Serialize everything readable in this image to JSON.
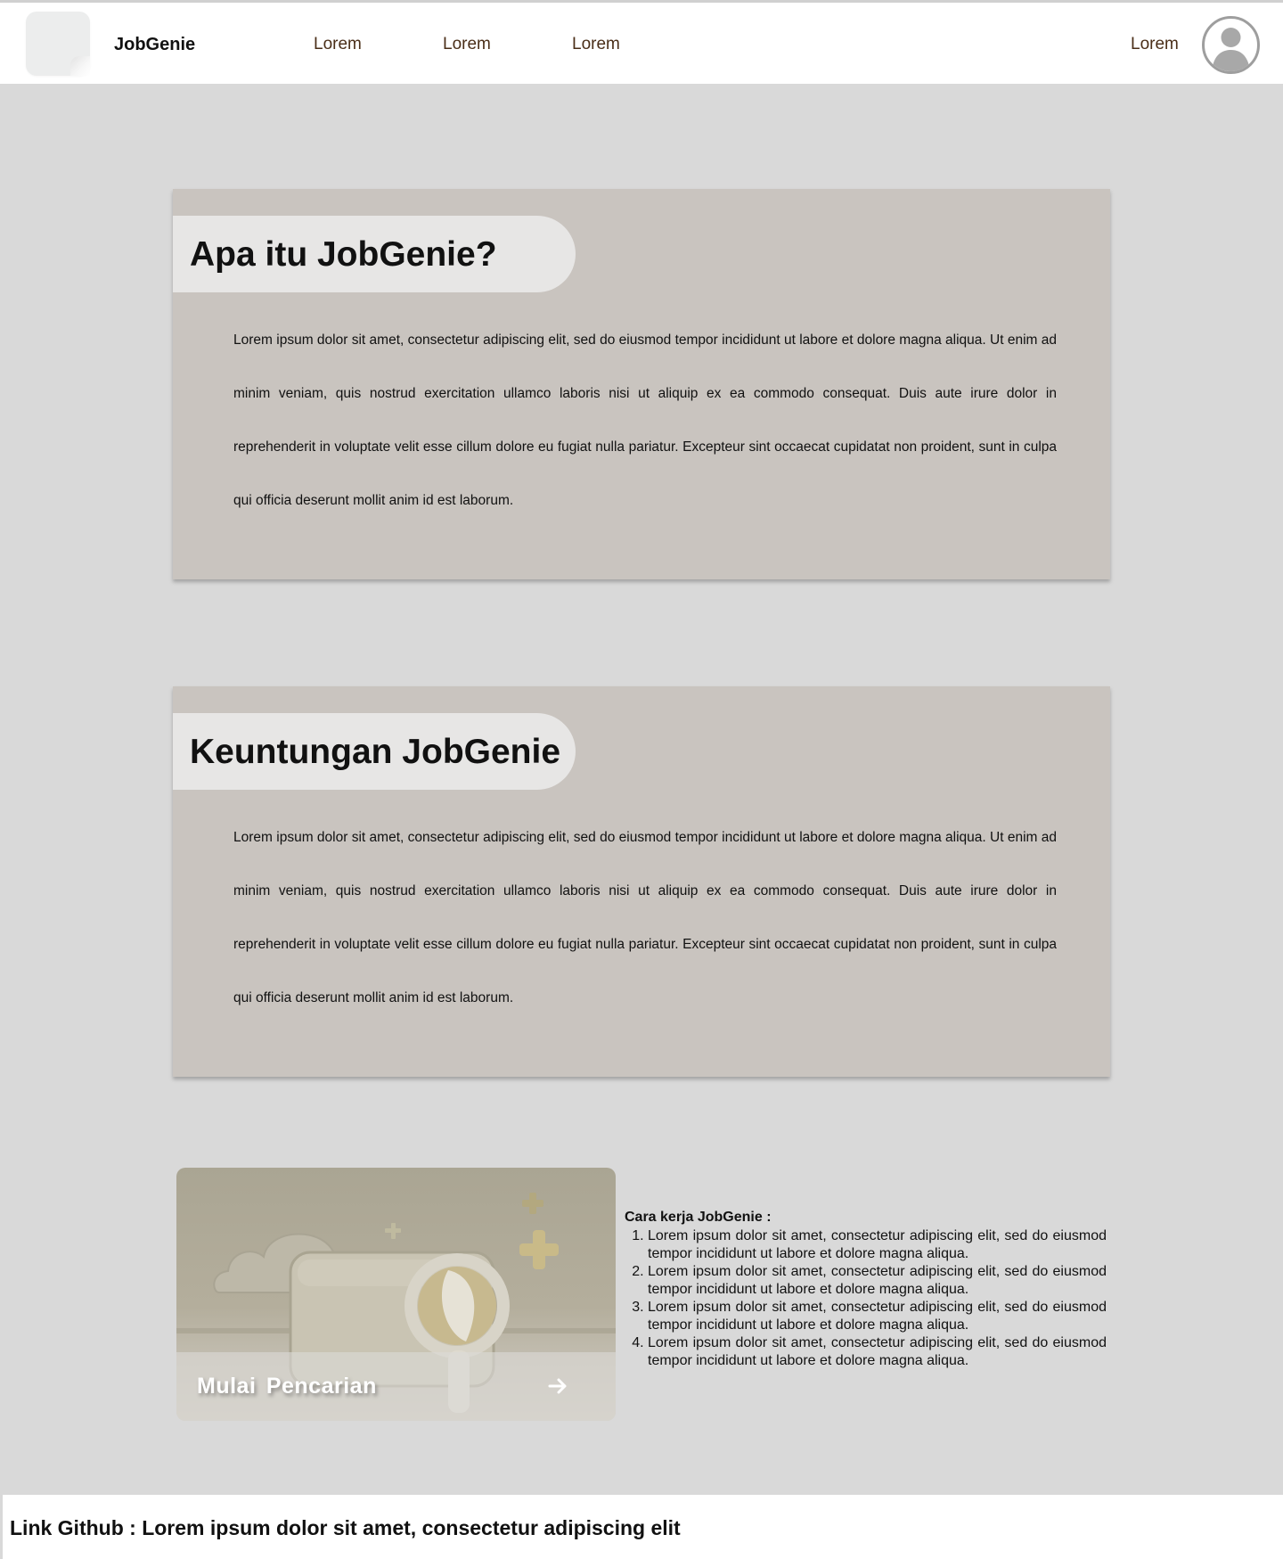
{
  "navbar": {
    "brand": "JobGenie",
    "links": [
      "Lorem",
      "Lorem",
      "Lorem"
    ],
    "right_link": "Lorem"
  },
  "sections": [
    {
      "title": "Apa itu JobGenie?",
      "body": "Lorem ipsum dolor sit amet, consectetur adipiscing elit, sed do eiusmod tempor incididunt ut labore et dolore magna aliqua. Ut enim ad minim veniam, quis nostrud exercitation ullamco laboris nisi ut aliquip ex ea commodo consequat. Duis aute irure dolor in reprehenderit in voluptate velit esse cillum dolore eu fugiat nulla pariatur. Excepteur sint occaecat cupidatat non proident, sunt in culpa qui officia deserunt mollit anim id est laborum."
    },
    {
      "title": "Keuntungan JobGenie",
      "body": "Lorem ipsum dolor sit amet, consectetur adipiscing elit, sed do eiusmod tempor incididunt ut labore et dolore magna aliqua. Ut enim ad minim veniam, quis nostrud exercitation ullamco laboris nisi ut aliquip ex ea commodo consequat. Duis aute irure dolor in reprehenderit in voluptate velit esse cillum dolore eu fugiat nulla pariatur. Excepteur sint occaecat cupidatat non proident, sunt in culpa qui officia deserunt mollit anim id est laborum."
    }
  ],
  "hero": {
    "label": "Mulai Pencarian",
    "icon": "arrow-right-icon"
  },
  "steps": {
    "title": "Cara kerja JobGenie :",
    "items": [
      "Lorem ipsum dolor sit amet, consectetur adipiscing elit, sed do eiusmod tempor incididunt ut labore et dolore magna aliqua.",
      "Lorem ipsum dolor sit amet, consectetur adipiscing elit, sed do eiusmod tempor incididunt ut labore et dolore magna aliqua.",
      "Lorem ipsum dolor sit amet, consectetur adipiscing elit, sed do eiusmod tempor incididunt ut labore et dolore magna aliqua.",
      "Lorem ipsum dolor sit amet, consectetur adipiscing elit, sed do eiusmod tempor incididunt ut labore et dolore magna aliqua."
    ]
  },
  "footer": {
    "text": "Link Github : Lorem ipsum dolor sit amet, consectetur adipiscing elit"
  },
  "colors": {
    "page_bg": "#d9d9d9",
    "card_bg": "#c9c4bf",
    "pill_bg": "#e7e6e5",
    "nav_link": "#4a2e18"
  }
}
